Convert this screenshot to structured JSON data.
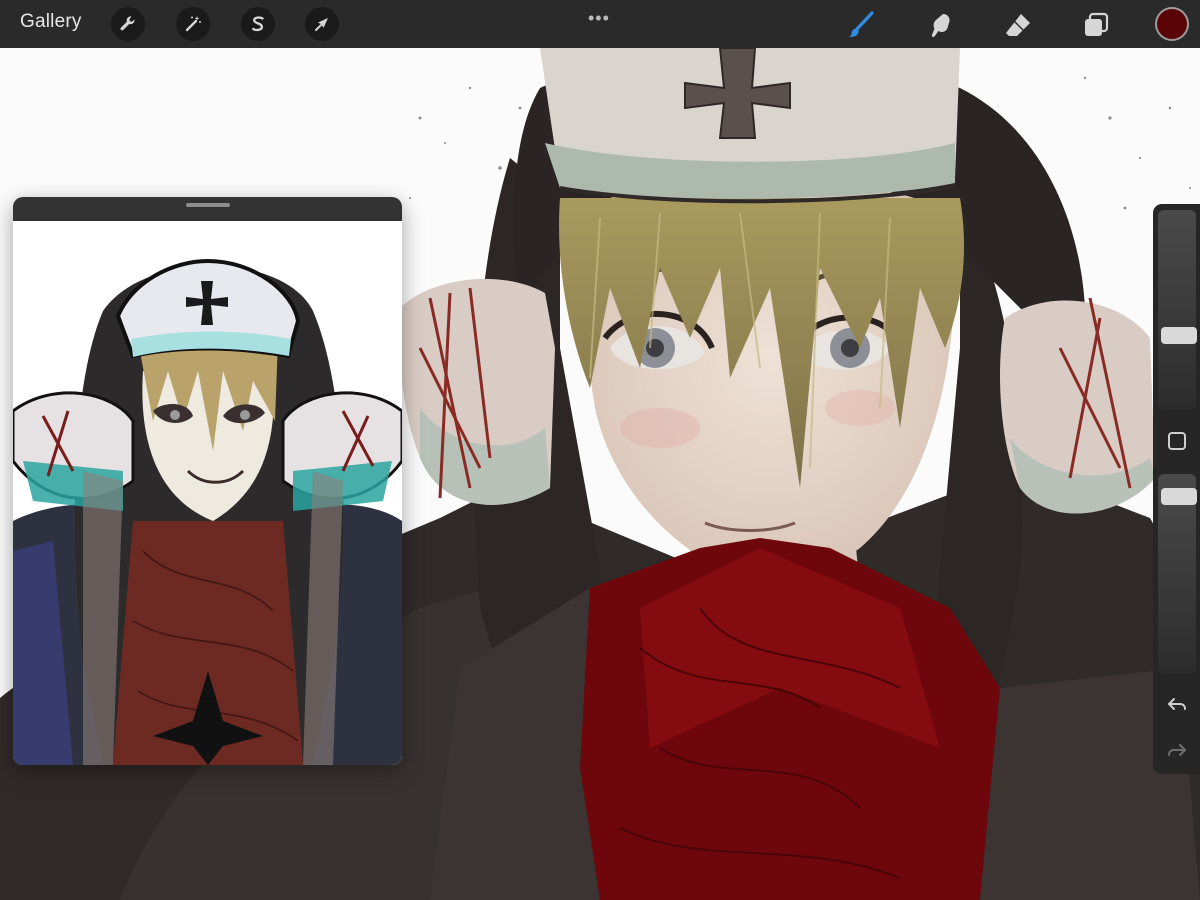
{
  "toolbar": {
    "gallery_label": "Gallery",
    "left_tools": [
      {
        "icon": "wrench-icon",
        "name": "actions"
      },
      {
        "icon": "magic-wand-icon",
        "name": "adjustments"
      },
      {
        "icon": "selection-s-icon",
        "name": "selection"
      },
      {
        "icon": "arrow-cursor-icon",
        "name": "transform"
      }
    ],
    "more_label": "•••",
    "right_tools": [
      {
        "icon": "brush-icon",
        "name": "paint",
        "active": true
      },
      {
        "icon": "smudge-icon",
        "name": "smudge"
      },
      {
        "icon": "eraser-icon",
        "name": "eraser"
      },
      {
        "icon": "layers-icon",
        "name": "layers"
      }
    ],
    "active_color": "#5a0408"
  },
  "colors": {
    "toolbar_bg": "#2a2a2a",
    "active_tool": "#2f8fe6",
    "canvas_bg": "#ffffff"
  },
  "reference": {
    "present": true
  },
  "sidebar": {
    "size_level": 0.36,
    "opacity_level": 0.19
  }
}
